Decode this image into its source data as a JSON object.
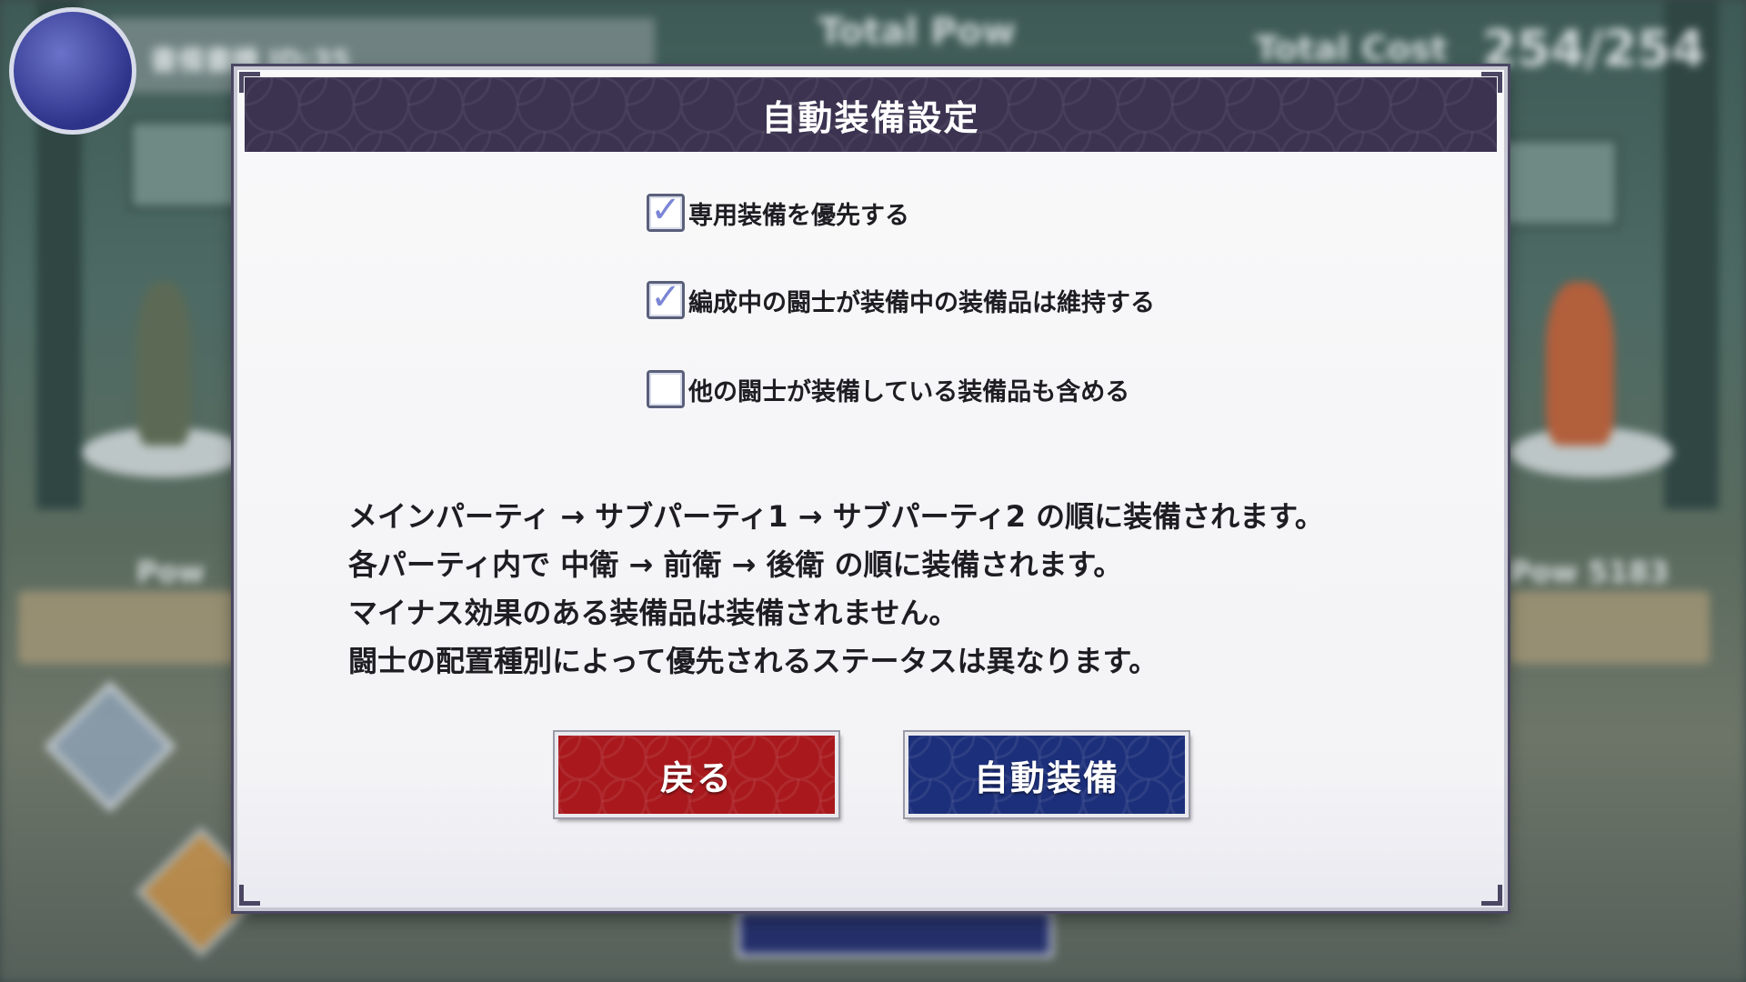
{
  "background": {
    "stage_label": "書備書機 ID:35",
    "total_pow_label": "Total Pow",
    "total_cost_label": "Total Cost",
    "total_cost_value": "254/254",
    "left_unit_label": "Pow",
    "right_unit_label": "Pow 5183"
  },
  "dialog": {
    "title": "自動装備設定",
    "options": [
      {
        "label": "専用装備を優先する",
        "checked": true
      },
      {
        "label": "編成中の闘士が装備中の装備品は維持する",
        "checked": true
      },
      {
        "label": "他の闘士が装備している装備品も含める",
        "checked": false
      }
    ],
    "checkmark_glyph": "✓",
    "description": [
      "メインパーティ → サブパーティ1 → サブパーティ2 の順に装備されます。",
      "各パーティ内で 中衛 → 前衛 → 後衛 の順に装備されます。",
      "マイナス効果のある装備品は装備されません。",
      "闘士の配置種別によって優先されるステータスは異なります。"
    ],
    "buttons": {
      "back_label": "戻る",
      "auto_equip_label": "自動装備"
    },
    "colors": {
      "header": "#3b3350",
      "back_button": "#a8181c",
      "auto_button": "#1c2f7a",
      "checkmark": "#7b86d6"
    }
  }
}
